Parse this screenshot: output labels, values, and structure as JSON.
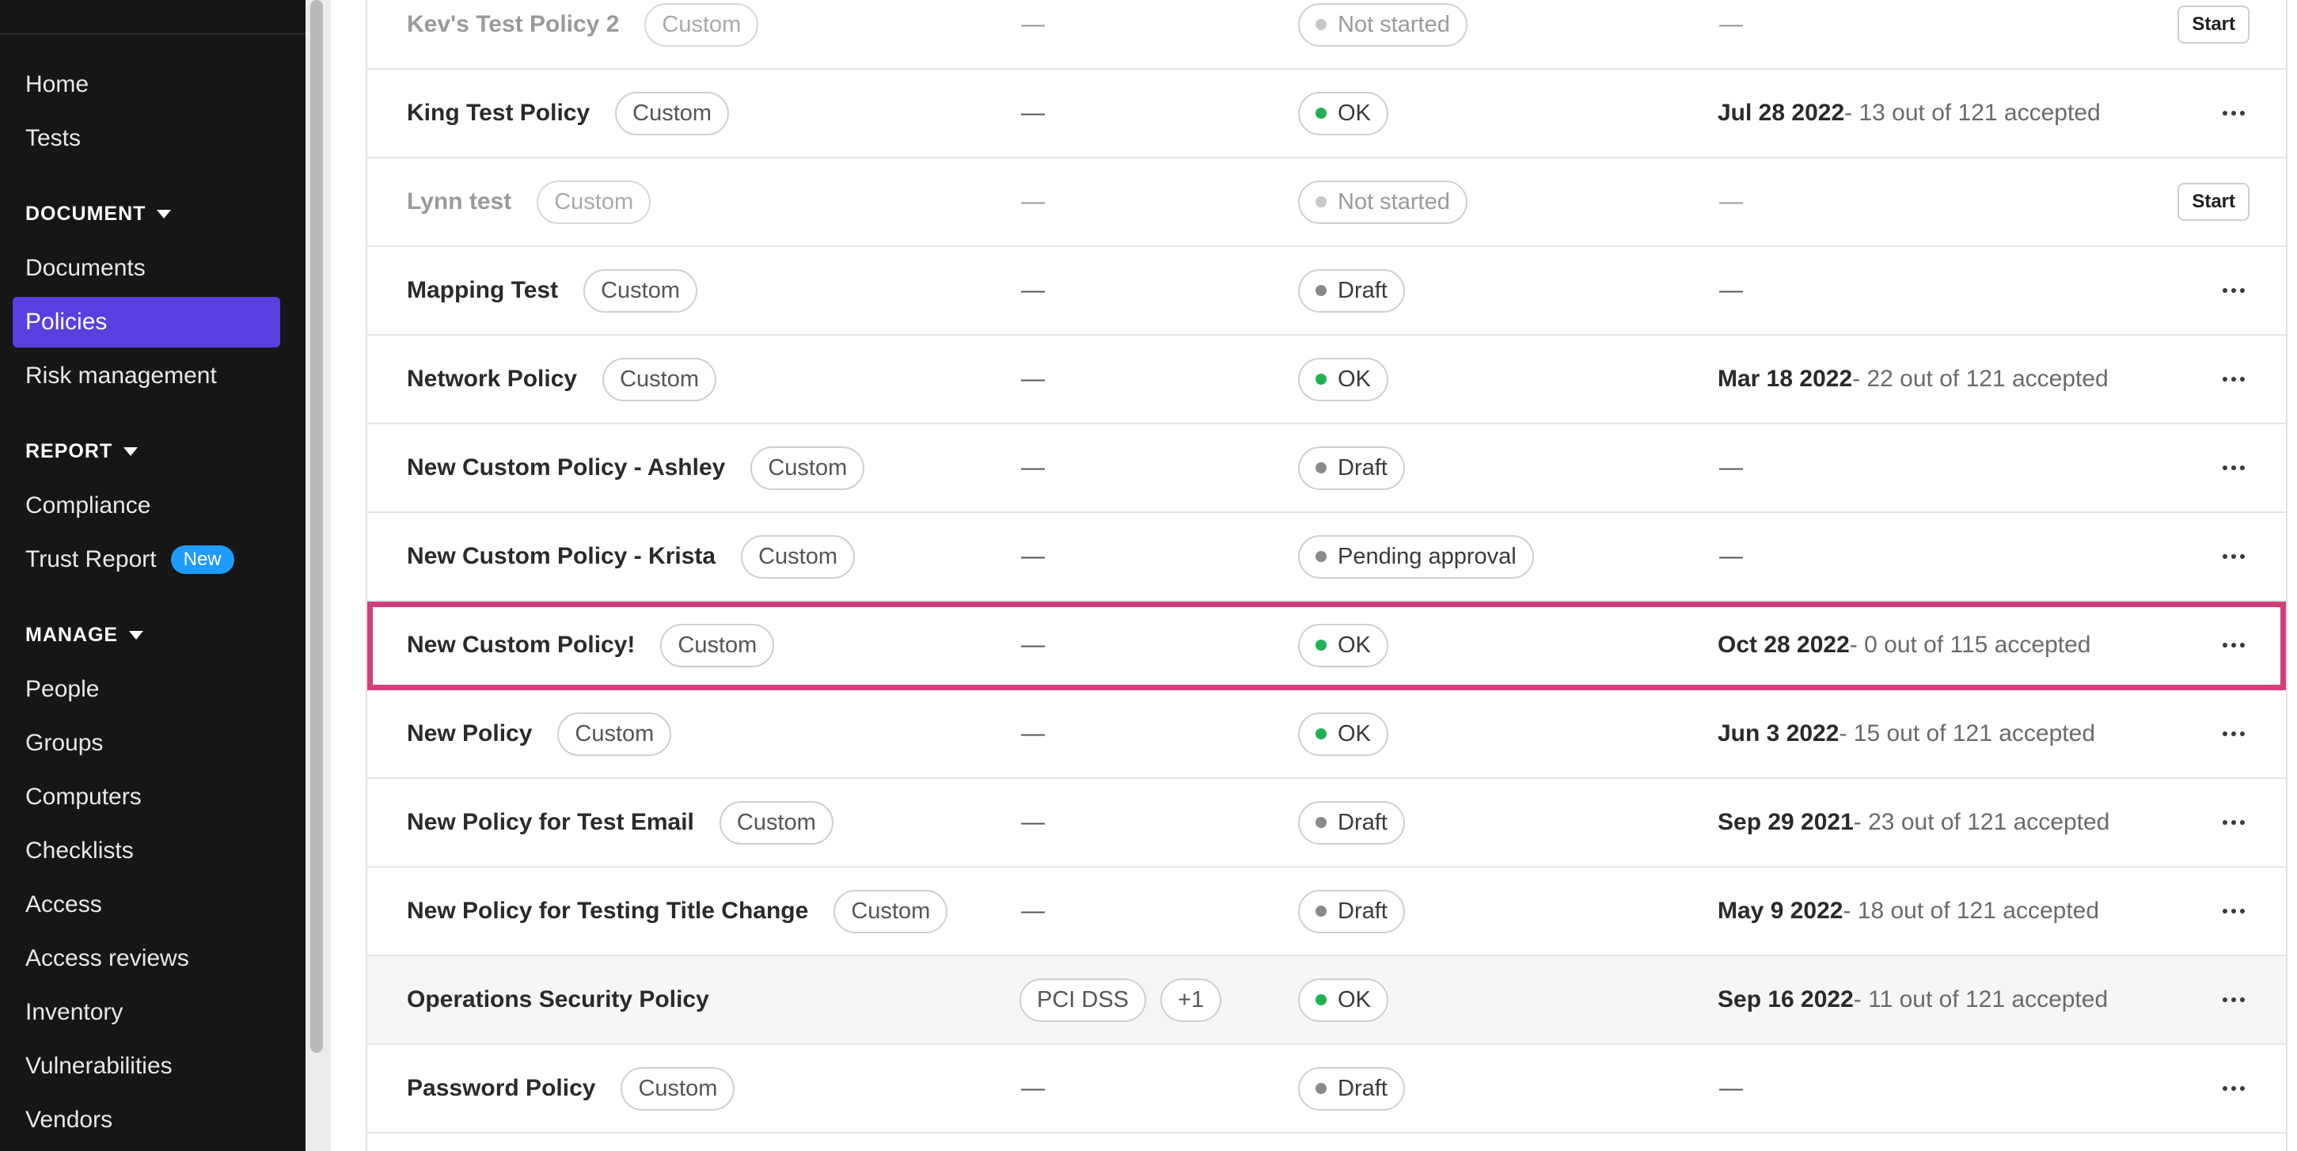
{
  "sidebar": {
    "home": "Home",
    "tests": "Tests",
    "document_section": "DOCUMENT",
    "documents": "Documents",
    "policies": "Policies",
    "risk_management": "Risk management",
    "report_section": "REPORT",
    "compliance": "Compliance",
    "trust_report": "Trust Report",
    "trust_report_badge": "New",
    "manage_section": "MANAGE",
    "people": "People",
    "groups": "Groups",
    "computers": "Computers",
    "checklists": "Checklists",
    "access": "Access",
    "access_reviews": "Access reviews",
    "inventory": "Inventory",
    "vulnerabilities": "Vulnerabilities",
    "vendors": "Vendors"
  },
  "rows": [
    {
      "name": "Kev's Test Policy 2",
      "tag": "Custom",
      "framework": "—",
      "status": "Not started",
      "accept_date": "",
      "accept_rest": "",
      "accept_dash": "—",
      "action": "Start"
    },
    {
      "name": "King Test Policy",
      "tag": "Custom",
      "framework": "—",
      "status": "OK",
      "accept_date": "Jul 28 2022",
      "accept_rest": " - 13 out of 121 accepted",
      "accept_dash": "",
      "action": "more"
    },
    {
      "name": "Lynn test",
      "tag": "Custom",
      "framework": "—",
      "status": "Not started",
      "accept_date": "",
      "accept_rest": "",
      "accept_dash": "—",
      "action": "Start"
    },
    {
      "name": "Mapping Test",
      "tag": "Custom",
      "framework": "—",
      "status": "Draft",
      "accept_date": "",
      "accept_rest": "",
      "accept_dash": "—",
      "action": "more"
    },
    {
      "name": "Network Policy",
      "tag": "Custom",
      "framework": "—",
      "status": "OK",
      "accept_date": "Mar 18 2022",
      "accept_rest": " - 22 out of 121 accepted",
      "accept_dash": "",
      "action": "more"
    },
    {
      "name": "New Custom Policy - Ashley",
      "tag": "Custom",
      "framework": "—",
      "status": "Draft",
      "accept_date": "",
      "accept_rest": "",
      "accept_dash": "—",
      "action": "more"
    },
    {
      "name": "New Custom Policy - Krista",
      "tag": "Custom",
      "framework": "—",
      "status": "Pending approval",
      "accept_date": "",
      "accept_rest": "",
      "accept_dash": "—",
      "action": "more"
    },
    {
      "name": "New Custom Policy!",
      "tag": "Custom",
      "framework": "—",
      "status": "OK",
      "accept_date": "Oct 28 2022",
      "accept_rest": " - 0 out of 115 accepted",
      "accept_dash": "",
      "action": "more"
    },
    {
      "name": "New Policy",
      "tag": "Custom",
      "framework": "—",
      "status": "OK",
      "accept_date": "Jun 3 2022",
      "accept_rest": " - 15 out of 121 accepted",
      "accept_dash": "",
      "action": "more"
    },
    {
      "name": "New Policy for Test Email",
      "tag": "Custom",
      "framework": "—",
      "status": "Draft",
      "accept_date": "Sep 29 2021",
      "accept_rest": " - 23 out of 121 accepted",
      "accept_dash": "",
      "action": "more"
    },
    {
      "name": "New Policy for Testing Title Change",
      "tag": "Custom",
      "framework": "—",
      "status": "Draft",
      "accept_date": "May 9 2022",
      "accept_rest": " - 18 out of 121 accepted",
      "accept_dash": "",
      "action": "more"
    },
    {
      "name": "Operations Security Policy",
      "tag": "",
      "framework_tags": [
        "PCI DSS",
        "+1"
      ],
      "status": "OK",
      "accept_date": "Sep 16 2022",
      "accept_rest": " - 11 out of 121 accepted",
      "accept_dash": "",
      "action": "more"
    },
    {
      "name": "Password Policy",
      "tag": "Custom",
      "framework": "—",
      "status": "Draft",
      "accept_date": "",
      "accept_rest": "",
      "accept_dash": "—",
      "action": "more"
    }
  ],
  "colors": {
    "sidebar_bg": "#161616",
    "active_nav": "#5a3fe0",
    "new_badge": "#1e9bff",
    "status_ok": "#1fb152",
    "highlight_outline": "#d1407a"
  }
}
